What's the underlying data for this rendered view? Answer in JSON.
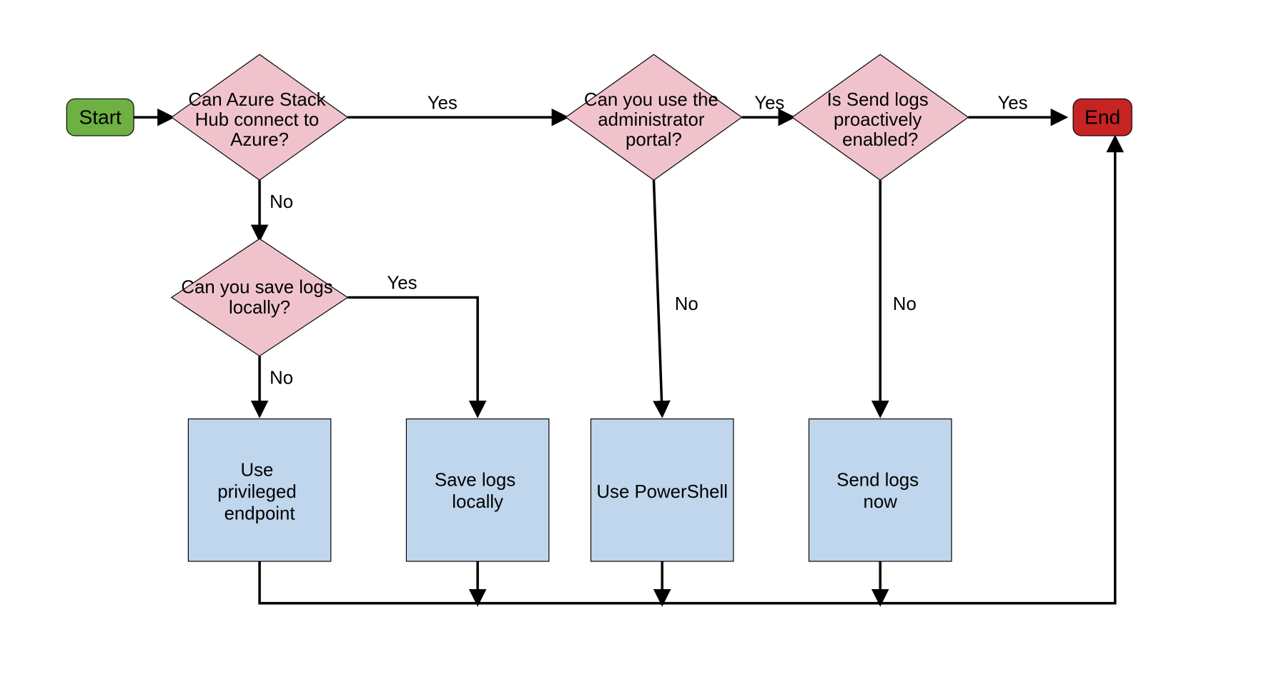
{
  "nodes": {
    "start": {
      "label": "Start"
    },
    "end": {
      "label": "End"
    },
    "d1": {
      "l1": "Can Azure Stack",
      "l2": "Hub connect to",
      "l3": "Azure?"
    },
    "d2": {
      "l1": "Can you use the",
      "l2": "administrator",
      "l3": "portal?"
    },
    "d3": {
      "l1": "Is Send logs",
      "l2": "proactively",
      "l3": "enabled?"
    },
    "d4": {
      "l1": "Can you save logs",
      "l2": "locally?"
    },
    "p1": {
      "l1": "Use",
      "l2": "privileged",
      "l3": "endpoint"
    },
    "p2": {
      "l1": "Save logs",
      "l2": "locally"
    },
    "p3": {
      "l1": "Use PowerShell"
    },
    "p4": {
      "l1": "Send logs",
      "l2": "now"
    }
  },
  "edgeLabels": {
    "yes": "Yes",
    "no": "No"
  }
}
